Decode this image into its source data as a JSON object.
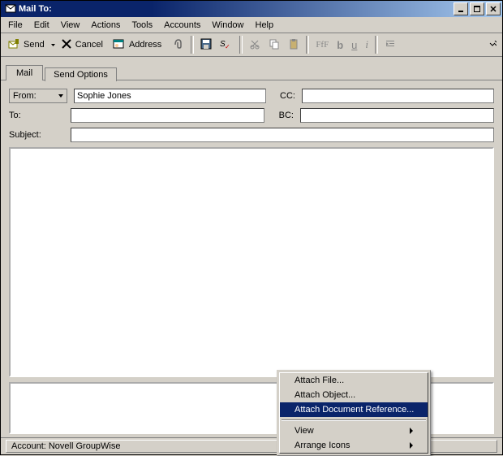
{
  "window": {
    "title": "Mail To:"
  },
  "menubar": {
    "items": [
      "File",
      "Edit",
      "View",
      "Actions",
      "Tools",
      "Accounts",
      "Window",
      "Help"
    ]
  },
  "toolbar": {
    "send": "Send",
    "cancel": "Cancel",
    "address": "Address",
    "tip_attach": "Attach",
    "tip_b": "b",
    "tip_u": "u",
    "tip_i": "i"
  },
  "tabs": {
    "mail": "Mail",
    "send_options": "Send Options"
  },
  "fields": {
    "from_label": "From:",
    "from_value": "Sophie Jones",
    "to_label": "To:",
    "to_value": "",
    "cc_label": "CC:",
    "cc_value": "",
    "bc_label": "BC:",
    "bc_value": "",
    "subject_label": "Subject:",
    "subject_value": ""
  },
  "context_menu": {
    "attach_file": "Attach File...",
    "attach_object": "Attach Object...",
    "attach_doc_ref": "Attach Document Reference...",
    "view": "View",
    "arrange": "Arrange Icons"
  },
  "status": {
    "account": "Account: Novell GroupWise"
  }
}
